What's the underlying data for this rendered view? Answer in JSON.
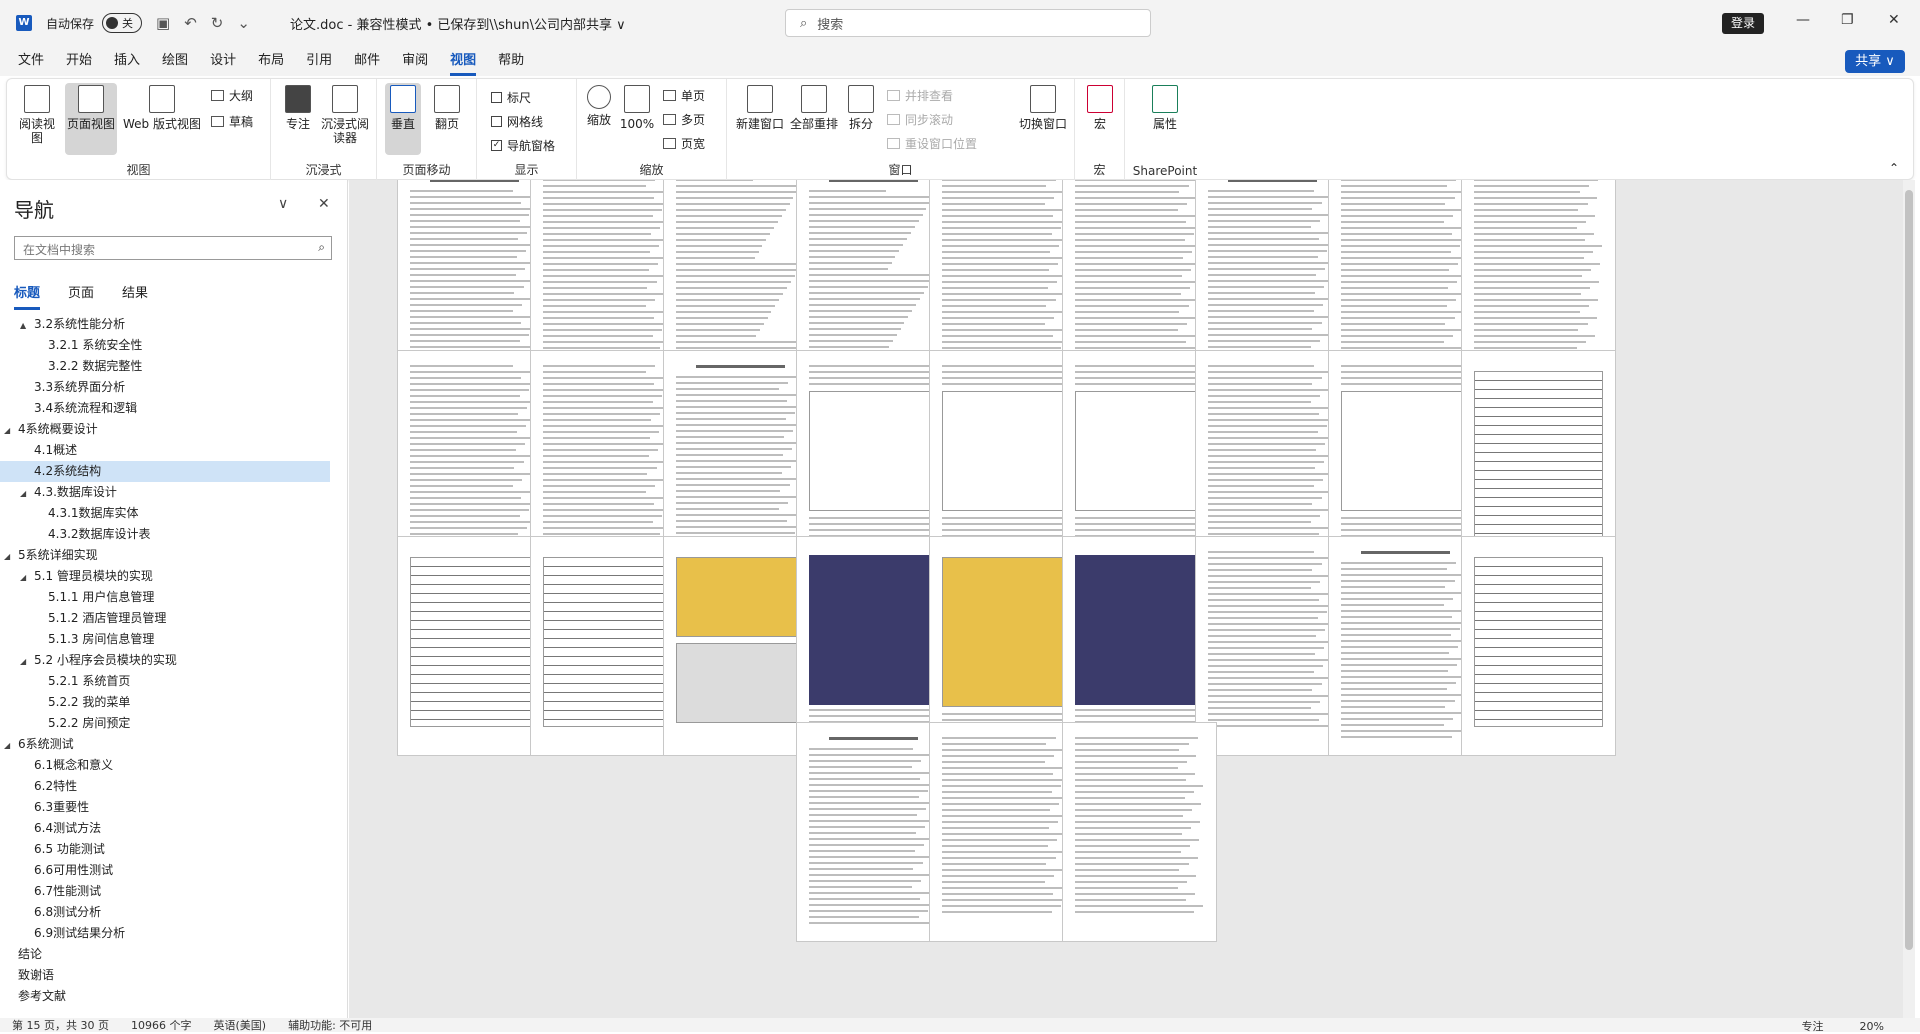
{
  "titlebar": {
    "autosave_label": "自动保存",
    "autosave_state": "关",
    "doc_title": "论文.doc  -  兼容性模式 • 已保存到\\\\shun\\公司内部共享 ∨",
    "search_placeholder": "搜索",
    "login_label": "登录"
  },
  "menu": {
    "items": [
      "文件",
      "开始",
      "插入",
      "绘图",
      "设计",
      "布局",
      "引用",
      "邮件",
      "审阅",
      "视图",
      "帮助"
    ],
    "active": "视图",
    "share_label": "共享"
  },
  "ribbon": {
    "views": {
      "name": "视图",
      "read": "阅读视图",
      "print": "页面视图",
      "web": "Web 版式视图",
      "outline": "大纲",
      "draft": "草稿"
    },
    "immersive": {
      "name": "沉浸式",
      "focus": "专注",
      "reader": "沉浸式阅读器"
    },
    "page_move": {
      "name": "页面移动",
      "vertical": "垂直",
      "side": "翻页"
    },
    "show": {
      "name": "显示",
      "ruler": "标尺",
      "gridlines": "网格线",
      "nav_pane": "导航窗格",
      "ruler_checked": false,
      "gridlines_checked": false,
      "nav_checked": true
    },
    "zoom": {
      "name": "缩放",
      "zoom_btn": "缩放",
      "hundred": "100%",
      "one_page": "单页",
      "multi_page": "多页",
      "page_width": "页宽"
    },
    "window": {
      "name": "窗口",
      "new": "新建窗口",
      "arrange": "全部重排",
      "split": "拆分",
      "side_by_side": "并排查看",
      "sync_scroll": "同步滚动",
      "reset_pos": "重设窗口位置",
      "switch": "切换窗口"
    },
    "macro": {
      "name": "宏",
      "macro_btn": "宏"
    },
    "sharepoint": {
      "name": "SharePoint",
      "props": "属性"
    }
  },
  "nav": {
    "title": "导航",
    "search_placeholder": "在文档中搜索",
    "tabs": [
      "标题",
      "页面",
      "结果"
    ],
    "active_tab": "标题",
    "selected_item": "4.2系统结构",
    "items": [
      {
        "label": "3.2系统性能分析",
        "level": 2,
        "arrow": "▲"
      },
      {
        "label": "3.2.1 系统安全性",
        "level": 3,
        "arrow": ""
      },
      {
        "label": "3.2.2 数据完整性",
        "level": 3,
        "arrow": ""
      },
      {
        "label": "3.3系统界面分析",
        "level": 2,
        "arrow": ""
      },
      {
        "label": "3.4系统流程和逻辑",
        "level": 2,
        "arrow": ""
      },
      {
        "label": "4系统概要设计",
        "level": 1,
        "arrow": "◢"
      },
      {
        "label": "4.1概述",
        "level": 2,
        "arrow": ""
      },
      {
        "label": "4.2系统结构",
        "level": 2,
        "arrow": ""
      },
      {
        "label": "4.3.数据库设计",
        "level": 2,
        "arrow": "◢"
      },
      {
        "label": "4.3.1数据库实体",
        "level": 3,
        "arrow": ""
      },
      {
        "label": "4.3.2数据库设计表",
        "level": 3,
        "arrow": ""
      },
      {
        "label": "5系统详细实现",
        "level": 1,
        "arrow": "◢"
      },
      {
        "label": "5.1 管理员模块的实现",
        "level": 2,
        "arrow": "◢"
      },
      {
        "label": "5.1.1 用户信息管理",
        "level": 3,
        "arrow": ""
      },
      {
        "label": "5.1.2 酒店管理员管理",
        "level": 3,
        "arrow": ""
      },
      {
        "label": "5.1.3 房间信息管理",
        "level": 3,
        "arrow": ""
      },
      {
        "label": "5.2 小程序会员模块的实现",
        "level": 2,
        "arrow": "◢"
      },
      {
        "label": "5.2.1 系统首页",
        "level": 3,
        "arrow": ""
      },
      {
        "label": "5.2.2 我的菜单",
        "level": 3,
        "arrow": ""
      },
      {
        "label": "5.2.2 房间预定",
        "level": 3,
        "arrow": ""
      },
      {
        "label": "6系统测试",
        "level": 1,
        "arrow": "◢"
      },
      {
        "label": "6.1概念和意义",
        "level": 2,
        "arrow": ""
      },
      {
        "label": "6.2特性",
        "level": 2,
        "arrow": ""
      },
      {
        "label": "6.3重要性",
        "level": 2,
        "arrow": ""
      },
      {
        "label": "6.4测试方法",
        "level": 2,
        "arrow": ""
      },
      {
        "label": "6.5 功能测试",
        "level": 2,
        "arrow": ""
      },
      {
        "label": "6.6可用性测试",
        "level": 2,
        "arrow": ""
      },
      {
        "label": "6.7性能测试",
        "level": 2,
        "arrow": ""
      },
      {
        "label": "6.8测试分析",
        "level": 2,
        "arrow": ""
      },
      {
        "label": "6.9测试结果分析",
        "level": 2,
        "arrow": ""
      },
      {
        "label": "结论",
        "level": 1,
        "arrow": ""
      },
      {
        "label": "致谢语",
        "level": 1,
        "arrow": ""
      },
      {
        "label": "参考文献",
        "level": 1,
        "arrow": ""
      }
    ]
  },
  "status": {
    "page": "第 15 页，共 30 页",
    "words": "10966 个字",
    "language": "英语(美国)",
    "accessibility": "辅助功能: 不可用",
    "focus": "专注",
    "zoom": "20%"
  }
}
